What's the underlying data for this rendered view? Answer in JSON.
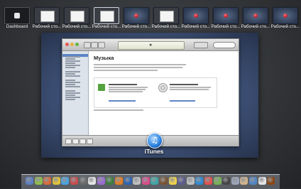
{
  "spaces": [
    {
      "label": "Dashboard",
      "kind": "dashboard"
    },
    {
      "label": "Рабочий сто...",
      "kind": "white"
    },
    {
      "label": "Рабочий сто...",
      "kind": "white"
    },
    {
      "label": "Рабочий сто...",
      "kind": "white-active"
    },
    {
      "label": "Рабочий сто...",
      "kind": "red"
    },
    {
      "label": "Рабочий сто...",
      "kind": "white"
    },
    {
      "label": "Рабочий сто...",
      "kind": "red"
    },
    {
      "label": "Рабочий сто...",
      "kind": "red"
    },
    {
      "label": "Рабочий сто...",
      "kind": "red"
    },
    {
      "label": "Рабочий сто...",
      "kind": "red"
    }
  ],
  "window": {
    "music_title": "Музыка",
    "app_name": "iTunes"
  },
  "dock": {
    "icon_colors": [
      "#5b7fc4",
      "#8fbf4a",
      "#d96a3a",
      "#e0c43b",
      "#4aa3df",
      "#c94b4b",
      "#6a6a6a",
      "#e6e6e6",
      "#9b6bd3",
      "#3b7f3b",
      "#e07f26",
      "#2b63b5",
      "#bfbfbf",
      "#d84c8a",
      "#3ea6a6",
      "#7a5230",
      "#f0d24a",
      "#5b5b8f",
      "#c0c0c0",
      "#2d8cd8",
      "#e35050",
      "#77b255",
      "#444444",
      "#9aa6b8",
      "#d2b48c",
      "#4f86c6",
      "#e6e6e6",
      "#8b4513"
    ]
  }
}
